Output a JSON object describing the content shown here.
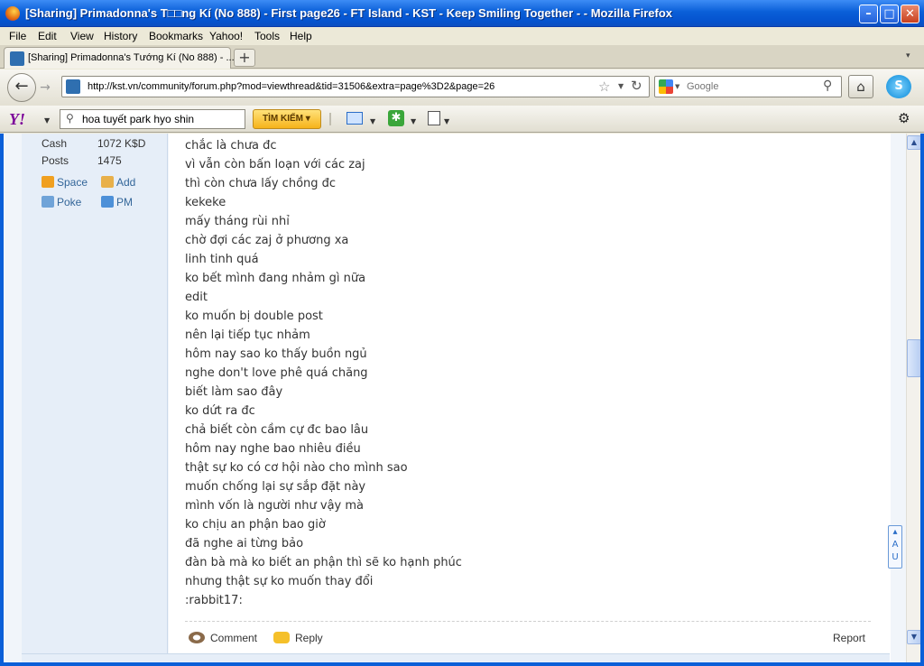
{
  "window": {
    "title": "[Sharing] Primadonna's T□□ng Kí (No 888) - First page26 - FT Island - KST - Keep Smiling Together - - Mozilla Firefox",
    "minimize": "–",
    "maximize": "□",
    "close": "✕"
  },
  "menu": [
    "File",
    "Edit",
    "View",
    "History",
    "Bookmarks",
    "Yahoo!",
    "Tools",
    "Help"
  ],
  "tabs": {
    "active_label": "[Sharing] Primadonna's Tướng Kí (No 888) - ...",
    "new_tab": "+",
    "list_arrow": "▾"
  },
  "navbar": {
    "back": "←",
    "forward": "→",
    "url": "http://kst.vn/community/forum.php?mod=viewthread&tid=31506&extra=page%3D2&page=26",
    "search_placeholder": "Google",
    "home": "⌂"
  },
  "yahoo_toolbar": {
    "logo": "Y!",
    "search_value": "hoa tuyết park hyo shin",
    "search_button": "TÌM KIẾM ▾"
  },
  "user_info": {
    "stats": [
      {
        "label": "Cash",
        "value": "1072 K$D"
      },
      {
        "label": "Posts",
        "value": "1475"
      }
    ],
    "links": [
      "Space",
      "Add",
      "Poke",
      "PM"
    ]
  },
  "post": {
    "lines": [
      "chắc là chưa đc",
      "vì vẫn còn bấn loạn với các zaj",
      "thì còn chưa lấy chồng đc",
      "kekeke",
      "mấy tháng rùi nhỉ",
      "chờ đợi các zaj ở phương xa",
      "linh tinh quá",
      "ko bết mình đang nhảm gì nữa",
      "edit",
      "ko muốn bị double post",
      "nên lại tiếp tục nhảm",
      "hôm nay sao ko thấy buồn ngủ",
      "nghe don't love phê quá chăng",
      "biết làm sao đây",
      "ko dứt ra đc",
      "chả biết còn cầm cự đc bao lâu",
      "hôm nay nghe bao nhiêu điều",
      "thật sự ko có cơ hội nào cho mình sao",
      "muốn chống lại sự sắp đặt này",
      "mình vốn là người như vậy mà",
      "ko chịu an phận bao giờ",
      "đã nghe ai từng bảo",
      "đàn bà mà ko biết an phận thì sẽ ko hạnh phúc",
      "nhưng thật sự ko muốn thay đổi",
      ":rabbit17:"
    ],
    "actions": {
      "comment": "Comment",
      "reply": "Reply",
      "report": "Report"
    }
  },
  "floater_text": "▴ A U",
  "scroll_position": 0.43
}
